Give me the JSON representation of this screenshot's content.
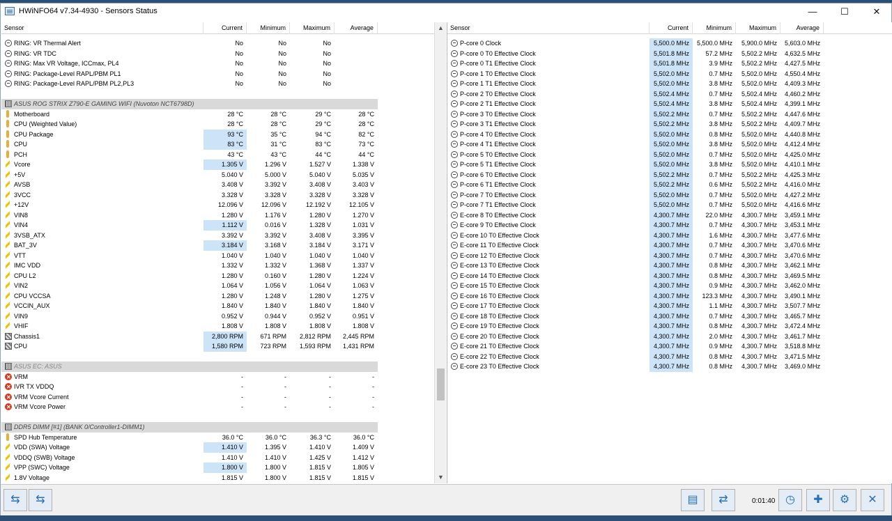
{
  "window": {
    "title": "HWiNFO64 v7.34-4930 - Sensors Status",
    "minimize": "—",
    "maximize": "☐",
    "close": "✕"
  },
  "columns": {
    "sensor": "Sensor",
    "current": "Current",
    "minimum": "Minimum",
    "maximum": "Maximum",
    "average": "Average"
  },
  "left_rows": [
    {
      "icon": "circle",
      "name": "RING: VR Thermal Alert",
      "cur": "No",
      "min": "No",
      "max": "No",
      "avg": ""
    },
    {
      "icon": "circle",
      "name": "RING: VR TDC",
      "cur": "No",
      "min": "No",
      "max": "No",
      "avg": ""
    },
    {
      "icon": "circle",
      "name": "RING: Max VR Voltage, ICCmax, PL4",
      "cur": "No",
      "min": "No",
      "max": "No",
      "avg": ""
    },
    {
      "icon": "circle",
      "name": "RING: Package-Level RAPL/PBM PL1",
      "cur": "No",
      "min": "No",
      "max": "No",
      "avg": ""
    },
    {
      "icon": "circle",
      "name": "RING: Package-Level RAPL/PBM PL2,PL3",
      "cur": "No",
      "min": "No",
      "max": "No",
      "avg": ""
    },
    {
      "type": "blank"
    },
    {
      "type": "group",
      "icon": "chip",
      "name": "ASUS ROG STRIX Z790-E GAMING WIFI (Nuvoton NCT6798D)"
    },
    {
      "icon": "therm",
      "name": "Motherboard",
      "cur": "28 °C",
      "min": "28 °C",
      "max": "29 °C",
      "avg": "28 °C"
    },
    {
      "icon": "therm",
      "name": "CPU (Weighted Value)",
      "cur": "28 °C",
      "min": "28 °C",
      "max": "29 °C",
      "avg": "28 °C"
    },
    {
      "icon": "therm",
      "name": "CPU Package",
      "cur": "93 °C",
      "min": "35 °C",
      "max": "94 °C",
      "avg": "82 °C",
      "hl": true
    },
    {
      "icon": "therm",
      "name": "CPU",
      "cur": "83 °C",
      "min": "31 °C",
      "max": "83 °C",
      "avg": "73 °C",
      "hl": true
    },
    {
      "icon": "therm",
      "name": "PCH",
      "cur": "43 °C",
      "min": "43 °C",
      "max": "44 °C",
      "avg": "44 °C"
    },
    {
      "icon": "bolt",
      "name": "Vcore",
      "cur": "1.305 V",
      "min": "1.296 V",
      "max": "1.527 V",
      "avg": "1.338 V",
      "hl": true
    },
    {
      "icon": "bolt",
      "name": "+5V",
      "cur": "5.040 V",
      "min": "5.000 V",
      "max": "5.040 V",
      "avg": "5.035 V"
    },
    {
      "icon": "bolt",
      "name": "AVSB",
      "cur": "3.408 V",
      "min": "3.392 V",
      "max": "3.408 V",
      "avg": "3.403 V"
    },
    {
      "icon": "bolt",
      "name": "3VCC",
      "cur": "3.328 V",
      "min": "3.328 V",
      "max": "3.328 V",
      "avg": "3.328 V"
    },
    {
      "icon": "bolt",
      "name": "+12V",
      "cur": "12.096 V",
      "min": "12.096 V",
      "max": "12.192 V",
      "avg": "12.105 V"
    },
    {
      "icon": "bolt",
      "name": "VIN8",
      "cur": "1.280 V",
      "min": "1.176 V",
      "max": "1.280 V",
      "avg": "1.270 V"
    },
    {
      "icon": "bolt",
      "name": "VIN4",
      "cur": "1.112 V",
      "min": "0.016 V",
      "max": "1.328 V",
      "avg": "1.031 V",
      "hl": true
    },
    {
      "icon": "bolt",
      "name": "3VSB_ATX",
      "cur": "3.392 V",
      "min": "3.392 V",
      "max": "3.408 V",
      "avg": "3.395 V"
    },
    {
      "icon": "bolt",
      "name": "BAT_3V",
      "cur": "3.184 V",
      "min": "3.168 V",
      "max": "3.184 V",
      "avg": "3.171 V",
      "hl": true
    },
    {
      "icon": "bolt",
      "name": "VTT",
      "cur": "1.040 V",
      "min": "1.040 V",
      "max": "1.040 V",
      "avg": "1.040 V"
    },
    {
      "icon": "bolt",
      "name": "IMC VDD",
      "cur": "1.332 V",
      "min": "1.332 V",
      "max": "1.368 V",
      "avg": "1.337 V"
    },
    {
      "icon": "bolt",
      "name": "CPU L2",
      "cur": "1.280 V",
      "min": "0.160 V",
      "max": "1.280 V",
      "avg": "1.224 V"
    },
    {
      "icon": "bolt",
      "name": "VIN2",
      "cur": "1.064 V",
      "min": "1.056 V",
      "max": "1.064 V",
      "avg": "1.063 V"
    },
    {
      "icon": "bolt",
      "name": "CPU VCCSA",
      "cur": "1.280 V",
      "min": "1.248 V",
      "max": "1.280 V",
      "avg": "1.275 V"
    },
    {
      "icon": "bolt",
      "name": "VCCIN_AUX",
      "cur": "1.840 V",
      "min": "1.840 V",
      "max": "1.840 V",
      "avg": "1.840 V"
    },
    {
      "icon": "bolt",
      "name": "VIN9",
      "cur": "0.952 V",
      "min": "0.944 V",
      "max": "0.952 V",
      "avg": "0.951 V"
    },
    {
      "icon": "bolt",
      "name": "VHIF",
      "cur": "1.808 V",
      "min": "1.808 V",
      "max": "1.808 V",
      "avg": "1.808 V"
    },
    {
      "icon": "fan",
      "name": "Chassis1",
      "cur": "2,800 RPM",
      "min": "671 RPM",
      "max": "2,812 RPM",
      "avg": "2,445 RPM",
      "hl": true
    },
    {
      "icon": "fan",
      "name": "CPU",
      "cur": "1,580 RPM",
      "min": "723 RPM",
      "max": "1,593 RPM",
      "avg": "1,431 RPM",
      "hl": true
    },
    {
      "type": "blank"
    },
    {
      "type": "group",
      "icon": "chip",
      "name": "ASUS EC: ASUS",
      "error": true
    },
    {
      "icon": "err",
      "name": "VRM",
      "cur": "-",
      "min": "-",
      "max": "-",
      "avg": "-"
    },
    {
      "icon": "err",
      "name": "IVR TX VDDQ",
      "cur": "-",
      "min": "-",
      "max": "-",
      "avg": "-"
    },
    {
      "icon": "err",
      "name": "VRM Vcore Current",
      "cur": "-",
      "min": "-",
      "max": "-",
      "avg": "-"
    },
    {
      "icon": "err",
      "name": "VRM Vcore Power",
      "cur": "-",
      "min": "-",
      "max": "-",
      "avg": "-"
    },
    {
      "type": "blank"
    },
    {
      "type": "group",
      "icon": "chip",
      "name": "DDR5 DIMM [#1] (BANK 0/Controller1-DIMM1)"
    },
    {
      "icon": "therm",
      "name": "SPD Hub Temperature",
      "cur": "36.0 °C",
      "min": "36.0 °C",
      "max": "36.3 °C",
      "avg": "36.0 °C"
    },
    {
      "icon": "bolt",
      "name": "VDD (SWA) Voltage",
      "cur": "1.410 V",
      "min": "1.395 V",
      "max": "1.410 V",
      "avg": "1.409 V",
      "hl": true
    },
    {
      "icon": "bolt",
      "name": "VDDQ (SWB) Voltage",
      "cur": "1.410 V",
      "min": "1.410 V",
      "max": "1.425 V",
      "avg": "1.412 V"
    },
    {
      "icon": "bolt",
      "name": "VPP (SWC) Voltage",
      "cur": "1.800 V",
      "min": "1.800 V",
      "max": "1.815 V",
      "avg": "1.805 V",
      "hl": true
    },
    {
      "icon": "bolt",
      "name": "1.8V Voltage",
      "cur": "1.815 V",
      "min": "1.800 V",
      "max": "1.815 V",
      "avg": "1.815 V"
    }
  ],
  "right_rows": [
    {
      "name": "P-core 0 Clock",
      "cur": "5,500.0 MHz",
      "min": "5,500.0 MHz",
      "max": "5,900.0 MHz",
      "avg": "5,603.0 MHz"
    },
    {
      "name": "P-core 0 T0 Effective Clock",
      "cur": "5,501.8 MHz",
      "min": "57.2 MHz",
      "max": "5,502.2 MHz",
      "avg": "4,632.5 MHz"
    },
    {
      "name": "P-core 0 T1 Effective Clock",
      "cur": "5,501.8 MHz",
      "min": "3.9 MHz",
      "max": "5,502.2 MHz",
      "avg": "4,427.5 MHz"
    },
    {
      "name": "P-core 1 T0 Effective Clock",
      "cur": "5,502.0 MHz",
      "min": "0.7 MHz",
      "max": "5,502.0 MHz",
      "avg": "4,550.4 MHz"
    },
    {
      "name": "P-core 1 T1 Effective Clock",
      "cur": "5,502.0 MHz",
      "min": "3.8 MHz",
      "max": "5,502.0 MHz",
      "avg": "4,409.3 MHz"
    },
    {
      "name": "P-core 2 T0 Effective Clock",
      "cur": "5,502.4 MHz",
      "min": "0.7 MHz",
      "max": "5,502.4 MHz",
      "avg": "4,460.2 MHz"
    },
    {
      "name": "P-core 2 T1 Effective Clock",
      "cur": "5,502.4 MHz",
      "min": "3.8 MHz",
      "max": "5,502.4 MHz",
      "avg": "4,399.1 MHz"
    },
    {
      "name": "P-core 3 T0 Effective Clock",
      "cur": "5,502.2 MHz",
      "min": "0.7 MHz",
      "max": "5,502.2 MHz",
      "avg": "4,447.6 MHz"
    },
    {
      "name": "P-core 3 T1 Effective Clock",
      "cur": "5,502.2 MHz",
      "min": "3.8 MHz",
      "max": "5,502.2 MHz",
      "avg": "4,409.7 MHz"
    },
    {
      "name": "P-core 4 T0 Effective Clock",
      "cur": "5,502.0 MHz",
      "min": "0.8 MHz",
      "max": "5,502.0 MHz",
      "avg": "4,440.8 MHz"
    },
    {
      "name": "P-core 4 T1 Effective Clock",
      "cur": "5,502.0 MHz",
      "min": "3.8 MHz",
      "max": "5,502.0 MHz",
      "avg": "4,412.4 MHz"
    },
    {
      "name": "P-core 5 T0 Effective Clock",
      "cur": "5,502.0 MHz",
      "min": "0.7 MHz",
      "max": "5,502.0 MHz",
      "avg": "4,425.0 MHz"
    },
    {
      "name": "P-core 5 T1 Effective Clock",
      "cur": "5,502.0 MHz",
      "min": "3.8 MHz",
      "max": "5,502.0 MHz",
      "avg": "4,410.1 MHz"
    },
    {
      "name": "P-core 6 T0 Effective Clock",
      "cur": "5,502.2 MHz",
      "min": "0.7 MHz",
      "max": "5,502.2 MHz",
      "avg": "4,425.3 MHz"
    },
    {
      "name": "P-core 6 T1 Effective Clock",
      "cur": "5,502.2 MHz",
      "min": "0.6 MHz",
      "max": "5,502.2 MHz",
      "avg": "4,416.0 MHz"
    },
    {
      "name": "P-core 7 T0 Effective Clock",
      "cur": "5,502.0 MHz",
      "min": "0.7 MHz",
      "max": "5,502.0 MHz",
      "avg": "4,427.2 MHz"
    },
    {
      "name": "P-core 7 T1 Effective Clock",
      "cur": "5,502.0 MHz",
      "min": "0.7 MHz",
      "max": "5,502.0 MHz",
      "avg": "4,416.6 MHz"
    },
    {
      "name": "E-core 8 T0 Effective Clock",
      "cur": "4,300.7 MHz",
      "min": "22.0 MHz",
      "max": "4,300.7 MHz",
      "avg": "3,459.1 MHz"
    },
    {
      "name": "E-core 9 T0 Effective Clock",
      "cur": "4,300.7 MHz",
      "min": "0.7 MHz",
      "max": "4,300.7 MHz",
      "avg": "3,453.1 MHz"
    },
    {
      "name": "E-core 10 T0 Effective Clock",
      "cur": "4,300.7 MHz",
      "min": "1.6 MHz",
      "max": "4,300.7 MHz",
      "avg": "3,477.6 MHz"
    },
    {
      "name": "E-core 11 T0 Effective Clock",
      "cur": "4,300.7 MHz",
      "min": "0.7 MHz",
      "max": "4,300.7 MHz",
      "avg": "3,470.6 MHz"
    },
    {
      "name": "E-core 12 T0 Effective Clock",
      "cur": "4,300.7 MHz",
      "min": "0.7 MHz",
      "max": "4,300.7 MHz",
      "avg": "3,470.6 MHz"
    },
    {
      "name": "E-core 13 T0 Effective Clock",
      "cur": "4,300.7 MHz",
      "min": "0.8 MHz",
      "max": "4,300.7 MHz",
      "avg": "3,462.1 MHz"
    },
    {
      "name": "E-core 14 T0 Effective Clock",
      "cur": "4,300.7 MHz",
      "min": "0.8 MHz",
      "max": "4,300.7 MHz",
      "avg": "3,469.5 MHz"
    },
    {
      "name": "E-core 15 T0 Effective Clock",
      "cur": "4,300.7 MHz",
      "min": "0.9 MHz",
      "max": "4,300.7 MHz",
      "avg": "3,462.0 MHz"
    },
    {
      "name": "E-core 16 T0 Effective Clock",
      "cur": "4,300.7 MHz",
      "min": "123.3 MHz",
      "max": "4,300.7 MHz",
      "avg": "3,490.1 MHz"
    },
    {
      "name": "E-core 17 T0 Effective Clock",
      "cur": "4,300.7 MHz",
      "min": "1.1 MHz",
      "max": "4,300.7 MHz",
      "avg": "3,507.7 MHz"
    },
    {
      "name": "E-core 18 T0 Effective Clock",
      "cur": "4,300.7 MHz",
      "min": "0.7 MHz",
      "max": "4,300.7 MHz",
      "avg": "3,465.7 MHz"
    },
    {
      "name": "E-core 19 T0 Effective Clock",
      "cur": "4,300.7 MHz",
      "min": "0.8 MHz",
      "max": "4,300.7 MHz",
      "avg": "3,472.4 MHz"
    },
    {
      "name": "E-core 20 T0 Effective Clock",
      "cur": "4,300.7 MHz",
      "min": "2.0 MHz",
      "max": "4,300.7 MHz",
      "avg": "3,461.7 MHz"
    },
    {
      "name": "E-core 21 T0 Effective Clock",
      "cur": "4,300.7 MHz",
      "min": "0.9 MHz",
      "max": "4,300.7 MHz",
      "avg": "3,518.8 MHz"
    },
    {
      "name": "E-core 22 T0 Effective Clock",
      "cur": "4,300.7 MHz",
      "min": "0.8 MHz",
      "max": "4,300.7 MHz",
      "avg": "3,471.5 MHz"
    },
    {
      "name": "E-core 23 T0 Effective Clock",
      "cur": "4,300.7 MHz",
      "min": "0.8 MHz",
      "max": "4,300.7 MHz",
      "avg": "3,469.0 MHz"
    }
  ],
  "scroll": {
    "up": "▲",
    "down": "▼"
  },
  "toolbar": {
    "nav_left": "⇆",
    "nav_right": "⇆",
    "report_icon": "▤",
    "network_icon": "⇄",
    "elapsed": "0:01:40",
    "clock_icon": "◷",
    "add_log_icon": "✚",
    "settings_icon": "⚙",
    "close_icon": "✕"
  }
}
